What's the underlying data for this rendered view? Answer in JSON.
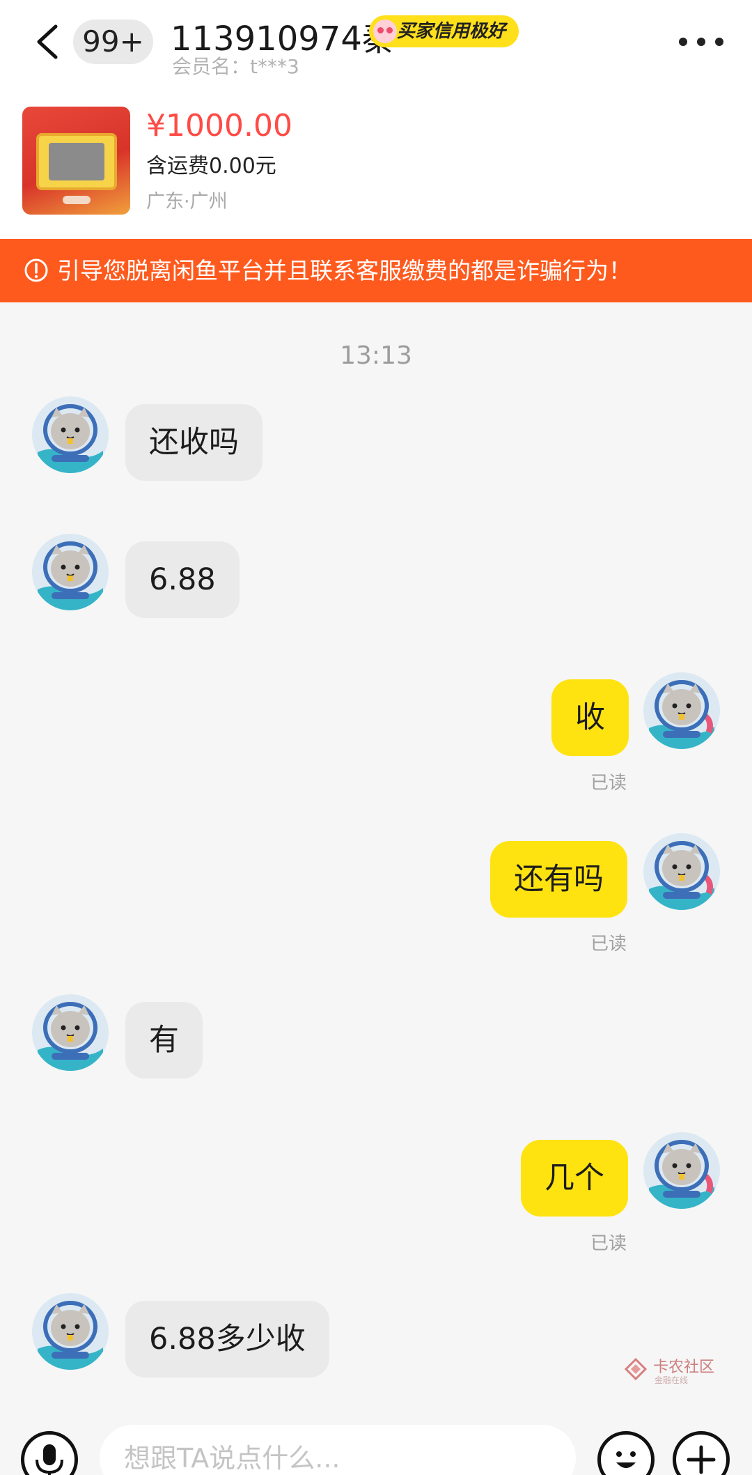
{
  "header": {
    "unread_badge": "99+",
    "contact_name": "113910974秦",
    "credit_tag": "买家信用极好",
    "member_name": "会员名：t***3"
  },
  "product": {
    "price": "¥1000.00",
    "shipping": "含运费0.00元",
    "location": "广东·广州"
  },
  "warning": {
    "text": "引导您脱离闲鱼平台并且联系客服缴费的都是诈骗行为！"
  },
  "chat": {
    "timestamp": "13:13",
    "read_label": "已读",
    "messages": [
      {
        "direction": "in",
        "text": "还收吗"
      },
      {
        "direction": "in",
        "text": "6.88"
      },
      {
        "direction": "out",
        "text": "收"
      },
      {
        "direction": "out",
        "text": "还有吗"
      },
      {
        "direction": "in",
        "text": "有"
      },
      {
        "direction": "out",
        "text": "几个"
      },
      {
        "direction": "in",
        "text": "6.88多少收"
      }
    ]
  },
  "input": {
    "placeholder": "想跟TA说点什么..."
  },
  "watermark": {
    "text": "卡农社区",
    "subtext": "金融在线"
  },
  "colors": {
    "outgoing_bubble": "#ffe311",
    "incoming_bubble": "#eaeaea",
    "warning_bar": "#ff5a1e",
    "price": "#ff4a45",
    "credit_tag": "#ffe01b"
  },
  "icons": [
    "back-icon",
    "more-icon",
    "warning-icon",
    "mic-icon",
    "emoji-icon",
    "plus-icon",
    "cat-avatar"
  ]
}
